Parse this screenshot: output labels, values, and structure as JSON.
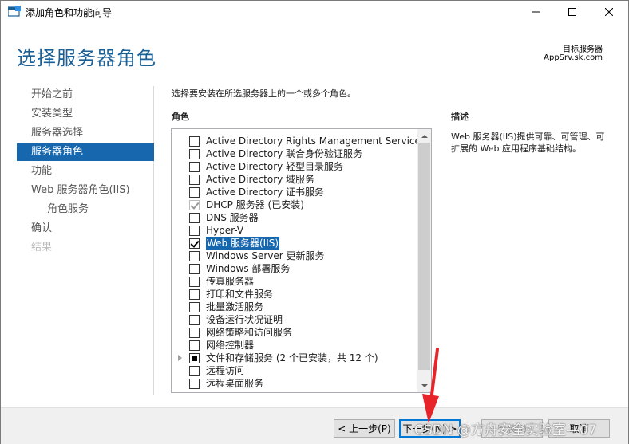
{
  "window": {
    "title": "添加角色和功能向导",
    "min_icon": "minimize-icon",
    "max_icon": "maximize-icon",
    "close_icon": "close-icon"
  },
  "header": {
    "page_title": "选择服务器角色",
    "target_label": "目标服务器",
    "target_name": "AppSrv.sk.com"
  },
  "nav": {
    "items": [
      {
        "label": "开始之前",
        "state": "normal"
      },
      {
        "label": "安装类型",
        "state": "normal"
      },
      {
        "label": "服务器选择",
        "state": "normal"
      },
      {
        "label": "服务器角色",
        "state": "active"
      },
      {
        "label": "功能",
        "state": "normal"
      },
      {
        "label": "Web 服务器角色(IIS)",
        "state": "normal"
      },
      {
        "label": "角色服务",
        "state": "normal"
      },
      {
        "label": "确认",
        "state": "normal"
      },
      {
        "label": "结果",
        "state": "disabled"
      }
    ]
  },
  "main": {
    "instruction": "选择要安装在所选服务器上的一个或多个角色。",
    "roles_header": "角色",
    "roles": [
      {
        "label": "Active Directory Rights Management Services",
        "checked": false
      },
      {
        "label": "Active Directory 联合身份验证服务",
        "checked": false
      },
      {
        "label": "Active Directory 轻型目录服务",
        "checked": false
      },
      {
        "label": "Active Directory 域服务",
        "checked": false
      },
      {
        "label": "Active Directory 证书服务",
        "checked": false
      },
      {
        "label": "DHCP 服务器 (已安装)",
        "checked": true,
        "disabled": true
      },
      {
        "label": "DNS 服务器",
        "checked": false
      },
      {
        "label": "Hyper-V",
        "checked": false
      },
      {
        "label": "Web 服务器(IIS)",
        "checked": true,
        "selected": true
      },
      {
        "label": "Windows Server 更新服务",
        "checked": false
      },
      {
        "label": "Windows 部署服务",
        "checked": false
      },
      {
        "label": "传真服务器",
        "checked": false
      },
      {
        "label": "打印和文件服务",
        "checked": false
      },
      {
        "label": "批量激活服务",
        "checked": false
      },
      {
        "label": "设备运行状况证明",
        "checked": false
      },
      {
        "label": "网络策略和访问服务",
        "checked": false
      },
      {
        "label": "网络控制器",
        "checked": false
      },
      {
        "label": "文件和存储服务 (2 个已安装，共 12 个)",
        "checked": false,
        "partial": true,
        "expandable": true
      },
      {
        "label": "远程访问",
        "checked": false
      },
      {
        "label": "远程桌面服务",
        "checked": false
      }
    ],
    "description_header": "描述",
    "description": "Web 服务器(IIS)提供可靠、可管理、可扩展的 Web 应用程序基础结构。"
  },
  "footer": {
    "prev": "< 上一步(P)",
    "next": "下一步(N) >",
    "install": "安装(I)",
    "cancel": "取消"
  },
  "watermark": "CSDN @方舟安全实验室—07",
  "colors": {
    "accent": "#1767ae",
    "title_blue": "#1a5f96",
    "arrow_red": "#e8242a"
  }
}
